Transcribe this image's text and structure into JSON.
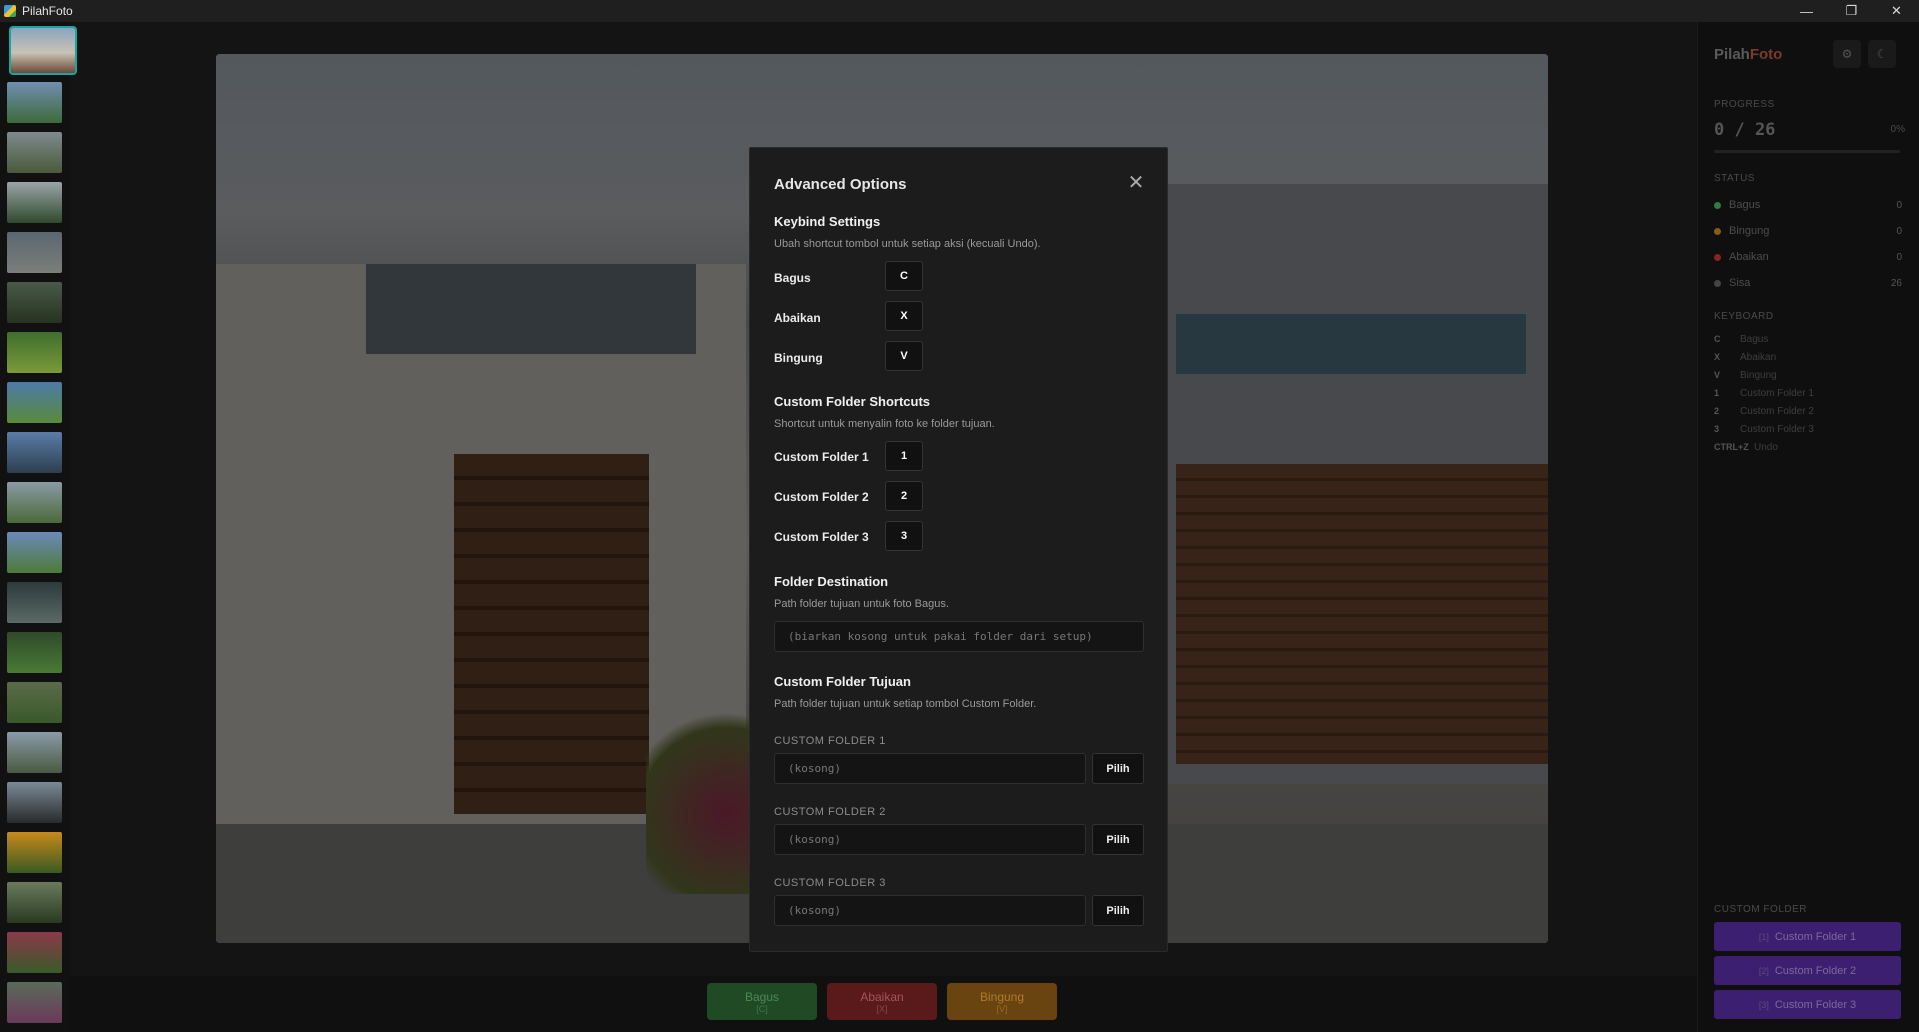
{
  "window": {
    "title": "PilahFoto",
    "controls": [
      "—",
      "❐",
      "✕"
    ]
  },
  "brand": {
    "name": "Pilah",
    "accent": "Foto"
  },
  "sidebar": {
    "progress_heading": "PROGRESS",
    "progress_text": "0 / 26",
    "progress_percent": "0%",
    "progress_value": 0,
    "status_heading": "STATUS",
    "status": [
      {
        "label": "Bagus",
        "count": "0",
        "color": "#2e7d3c"
      },
      {
        "label": "Bingung",
        "count": "0",
        "color": "#8a5a12"
      },
      {
        "label": "Abaikan",
        "count": "0",
        "color": "#8a2222"
      },
      {
        "label": "Sisa",
        "count": "26",
        "color": "#444444"
      }
    ],
    "keyboard_heading": "KEYBOARD",
    "keyboard": [
      {
        "key": "C",
        "label": "Bagus"
      },
      {
        "key": "X",
        "label": "Abaikan"
      },
      {
        "key": "V",
        "label": "Bingung"
      },
      {
        "key": "1",
        "label": "Custom Folder 1"
      },
      {
        "key": "2",
        "label": "Custom Folder 2"
      },
      {
        "key": "3",
        "label": "Custom Folder 3"
      },
      {
        "key": "CTRL+Z",
        "label": "Undo"
      }
    ],
    "custom_folder_heading": "CUSTOM FOLDER",
    "custom_folders": [
      {
        "key": "[1]",
        "label": "Custom Folder 1"
      },
      {
        "key": "[2]",
        "label": "Custom Folder 2"
      },
      {
        "key": "[3]",
        "label": "Custom Folder 3"
      }
    ]
  },
  "actions": [
    {
      "label": "Bagus",
      "key": "[C]",
      "bg": "#1f4a24",
      "fg": "#4c8a55"
    },
    {
      "label": "Abaikan",
      "key": "[X]",
      "bg": "#5a1a1a",
      "fg": "#a55555"
    },
    {
      "label": "Bingung",
      "key": "[V]",
      "bg": "#6a4410",
      "fg": "#b07a2a"
    }
  ],
  "modal": {
    "title": "Advanced Options",
    "keybind": {
      "heading": "Keybind Settings",
      "desc": "Ubah shortcut tombol untuk setiap aksi (kecuali Undo).",
      "rows": [
        {
          "label": "Bagus",
          "key": "C"
        },
        {
          "label": "Abaikan",
          "key": "X"
        },
        {
          "label": "Bingung",
          "key": "V"
        }
      ]
    },
    "custom_shortcuts": {
      "heading": "Custom Folder Shortcuts",
      "desc": "Shortcut untuk menyalin foto ke folder tujuan.",
      "rows": [
        {
          "label": "Custom Folder 1",
          "key": "1"
        },
        {
          "label": "Custom Folder 2",
          "key": "2"
        },
        {
          "label": "Custom Folder 3",
          "key": "3"
        }
      ]
    },
    "destination": {
      "heading": "Folder Destination",
      "desc": "Path folder tujuan untuk foto Bagus.",
      "placeholder": "(biarkan kosong untuk pakai folder dari setup)"
    },
    "custom_destination": {
      "heading": "Custom Folder Tujuan",
      "desc": "Path folder tujuan untuk setiap tombol Custom Folder.",
      "pick_label": "Pilih",
      "folders": [
        {
          "label": "CUSTOM FOLDER 1",
          "placeholder": "(kosong)"
        },
        {
          "label": "CUSTOM FOLDER 2",
          "placeholder": "(kosong)"
        },
        {
          "label": "CUSTOM FOLDER 3",
          "placeholder": "(kosong)"
        }
      ]
    }
  }
}
